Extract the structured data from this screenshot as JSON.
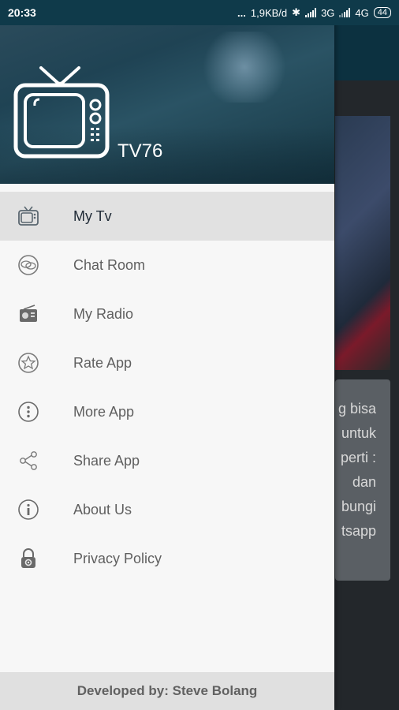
{
  "status_bar": {
    "time": "20:33",
    "dots": "...",
    "speed": "1,9KB/d",
    "net1": "3G",
    "net2": "4G",
    "battery": "44"
  },
  "drawer": {
    "app_title": "TV76",
    "menu": [
      {
        "label": "My Tv",
        "icon": "tv-icon",
        "active": true
      },
      {
        "label": "Chat Room",
        "icon": "chat-icon",
        "active": false
      },
      {
        "label": "My Radio",
        "icon": "radio-icon",
        "active": false
      },
      {
        "label": "Rate App",
        "icon": "star-icon",
        "active": false
      },
      {
        "label": "More App",
        "icon": "more-vertical-icon",
        "active": false
      },
      {
        "label": "Share App",
        "icon": "share-icon",
        "active": false
      },
      {
        "label": "About Us",
        "icon": "info-icon",
        "active": false
      },
      {
        "label": "Privacy Policy",
        "icon": "lock-icon",
        "active": false
      }
    ],
    "footer": "Developed by: Steve Bolang"
  },
  "background": {
    "card_lines": [
      "g bisa",
      "untuk",
      "perti :",
      "dan",
      "bungi",
      "tsapp"
    ]
  },
  "colors": {
    "header": "#1f4354",
    "active_item": "#e1e1e1",
    "statusbar": "#0f3a4a"
  }
}
